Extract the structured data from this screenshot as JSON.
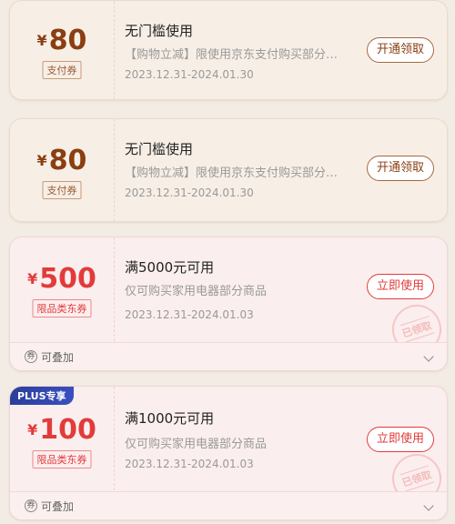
{
  "coupons": [
    {
      "currency": "¥",
      "amount": "80",
      "tag": "支付券",
      "title": "无门槛使用",
      "desc": "【购物立减】限使用京东支付购买部分商品",
      "date": "2023.12.31-2024.01.30",
      "button": "开通领取"
    },
    {
      "currency": "¥",
      "amount": "80",
      "tag": "支付券",
      "title": "无门槛使用",
      "desc": "【购物立减】限使用京东支付购买部分商品",
      "date": "2023.12.31-2024.01.30",
      "button": "开通领取"
    },
    {
      "currency": "¥",
      "amount": "500",
      "tag": "限品类东券",
      "title": "满5000元可用",
      "desc": "仅可购买家用电器部分商品",
      "date": "2023.12.31-2024.01.03",
      "button": "立即使用",
      "stamp": "已领取",
      "footer": "可叠加"
    },
    {
      "badge": "PLUS专享",
      "currency": "¥",
      "amount": "100",
      "tag": "限品类东券",
      "title": "满1000元可用",
      "desc": "仅可购买家用电器部分商品",
      "date": "2023.12.31-2024.01.03",
      "button": "立即使用",
      "stamp": "已领取",
      "footer": "可叠加"
    }
  ],
  "footer_icon": "券",
  "colors": {
    "beige_amount": "#8a3e12",
    "red_amount": "#e23b3b",
    "plus_badge": "#2c3e9c"
  }
}
